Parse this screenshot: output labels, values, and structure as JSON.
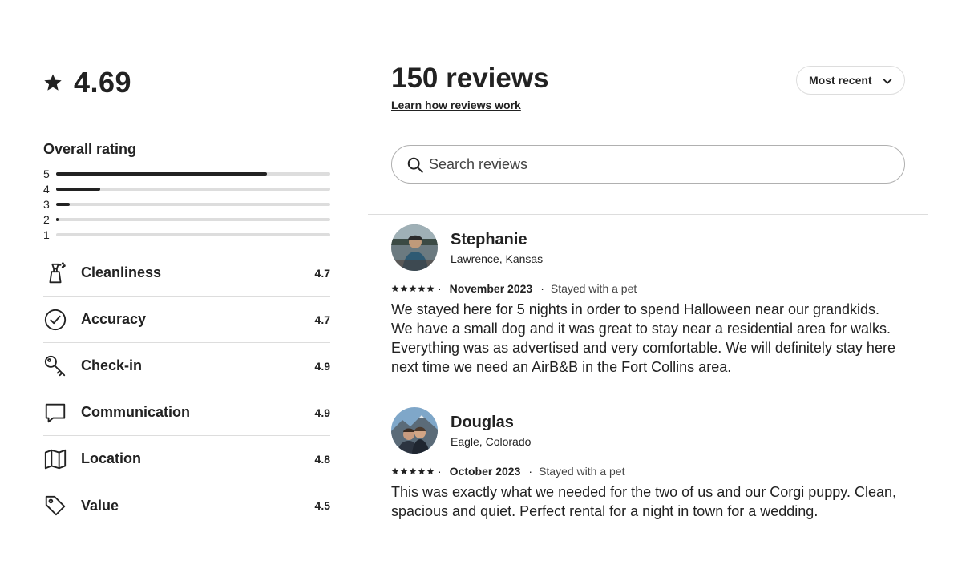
{
  "overall": {
    "score": "4.69",
    "rating_title": "Overall rating"
  },
  "distribution": [
    {
      "label": "5",
      "fraction": 0.77
    },
    {
      "label": "4",
      "fraction": 0.16
    },
    {
      "label": "3",
      "fraction": 0.05
    },
    {
      "label": "2",
      "fraction": 0.01
    },
    {
      "label": "1",
      "fraction": 0.0
    }
  ],
  "categories": [
    {
      "name": "Cleanliness",
      "value": "4.7",
      "icon": "spray-bottle-icon"
    },
    {
      "name": "Accuracy",
      "value": "4.7",
      "icon": "check-circle-icon"
    },
    {
      "name": "Check-in",
      "value": "4.9",
      "icon": "key-icon"
    },
    {
      "name": "Communication",
      "value": "4.9",
      "icon": "message-bubble-icon"
    },
    {
      "name": "Location",
      "value": "4.8",
      "icon": "map-icon"
    },
    {
      "name": "Value",
      "value": "4.5",
      "icon": "tag-icon"
    }
  ],
  "header": {
    "title": "150 reviews",
    "learn_link": "Learn how reviews work",
    "sort_label": "Most recent"
  },
  "search": {
    "placeholder": "Search reviews"
  },
  "reviews": [
    {
      "name": "Stephanie",
      "location": "Lawrence, Kansas",
      "date": "November 2023",
      "stay": "Stayed with a pet",
      "text": "We stayed here for 5 nights in order to spend Halloween near our grandkids. We have a small dog and it was great to stay near a residential area for walks. Everything was as advertised and very comfortable. We will definitely stay here next time we need an AirB&B in the Fort Collins area."
    },
    {
      "name": "Douglas",
      "location": "Eagle, Colorado",
      "date": "October 2023",
      "stay": "Stayed with a pet",
      "text": "This was exactly what we needed for the two of us and our Corgi puppy. Clean, spacious and quiet. Perfect rental for a night in town for a wedding."
    }
  ],
  "separator": "·"
}
